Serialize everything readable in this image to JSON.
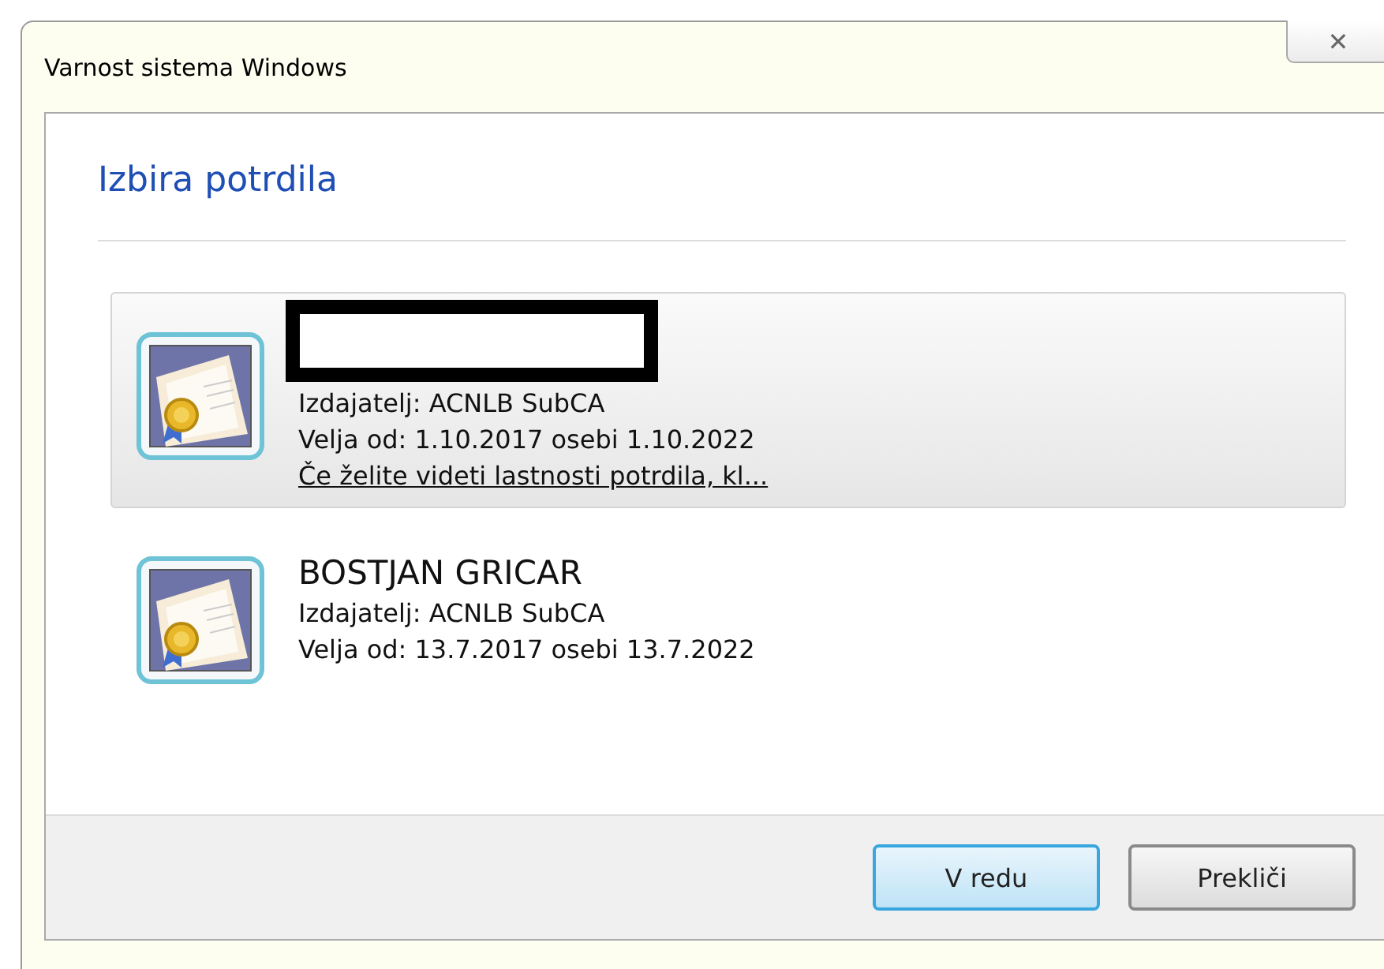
{
  "window": {
    "title": "Varnost sistema Windows",
    "close": "✕"
  },
  "heading": "Izbira potrdila",
  "certificates": [
    {
      "redacted": true,
      "issuer": "Izdajatelj: ACNLB SubCA",
      "validity": "Velja od: 1.10.2017 osebi 1.10.2022",
      "link": "Če želite videti lastnosti potrdila, kl...",
      "selected": true
    },
    {
      "name": "BOSTJAN GRICAR",
      "redacted": false,
      "issuer": "Izdajatelj: ACNLB SubCA",
      "validity": "Velja od: 13.7.2017 osebi 13.7.2022",
      "selected": false
    }
  ],
  "buttons": [
    {
      "label": "V redu",
      "kind": "default"
    },
    {
      "label": "Prekliči",
      "kind": "normal"
    }
  ]
}
